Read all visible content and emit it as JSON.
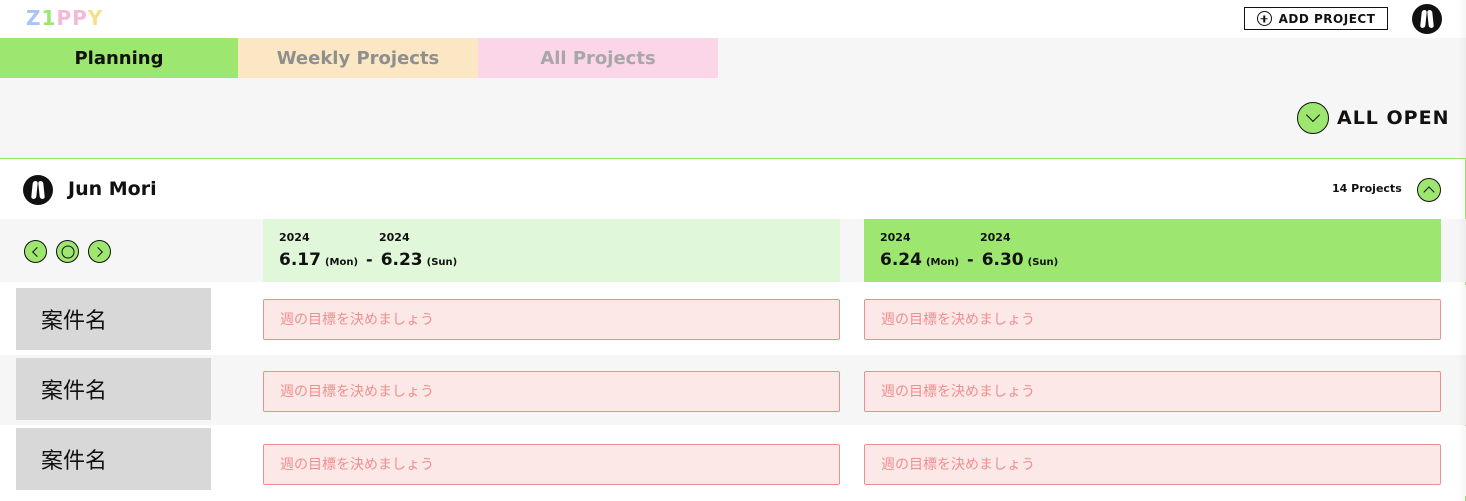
{
  "header": {
    "logo_letters": [
      "Z",
      "1",
      "P",
      "P",
      "Y"
    ],
    "logo_colors": [
      "#a9c4f5",
      "#9de66f",
      "#f5b8d8",
      "#f5b8d8",
      "#f7e08a"
    ],
    "add_project_label": "ADD PROJECT"
  },
  "tabs": [
    {
      "label": "Planning",
      "active": true,
      "color": "#9de66f"
    },
    {
      "label": "Weekly Projects",
      "active": false,
      "color": "#fbe7c4"
    },
    {
      "label": "All Projects",
      "active": false,
      "color": "#fbd5e8"
    }
  ],
  "toolbar": {
    "all_open_label": "ALL OPEN"
  },
  "user": {
    "name": "Jun Mori",
    "project_count": "14 Projects"
  },
  "weeks": [
    {
      "start_year": "2024",
      "end_year": "2024",
      "start": "6.17",
      "start_dow": "(Mon)",
      "end": "6.23",
      "end_dow": "(Sun)",
      "separator": "-",
      "highlight": "#e0f7da"
    },
    {
      "start_year": "2024",
      "end_year": "2024",
      "start": "6.24",
      "start_dow": "(Mon)",
      "end": "6.30",
      "end_dow": "(Sun)",
      "separator": "-",
      "highlight": "#9de66f"
    }
  ],
  "rows": [
    {
      "project_name": "案件名",
      "goals": [
        "週の目標を決めましょう",
        "週の目標を決めましょう"
      ]
    },
    {
      "project_name": "案件名",
      "goals": [
        "週の目標を決めましょう",
        "週の目標を決めましょう"
      ]
    },
    {
      "project_name": "案件名",
      "goals": [
        "週の目標を決めましょう",
        "週の目標を決めましょう"
      ]
    }
  ],
  "colors": {
    "accent": "#9de66f",
    "goal_border": "#ef8e8e",
    "goal_bg": "#fde8e8"
  },
  "icons": {
    "add": "plus-circle-icon",
    "expand": "chevron-down-icon",
    "collapse": "chevron-up-icon",
    "prev": "chevron-left-icon",
    "today": "circle-icon",
    "next": "chevron-right-icon"
  }
}
